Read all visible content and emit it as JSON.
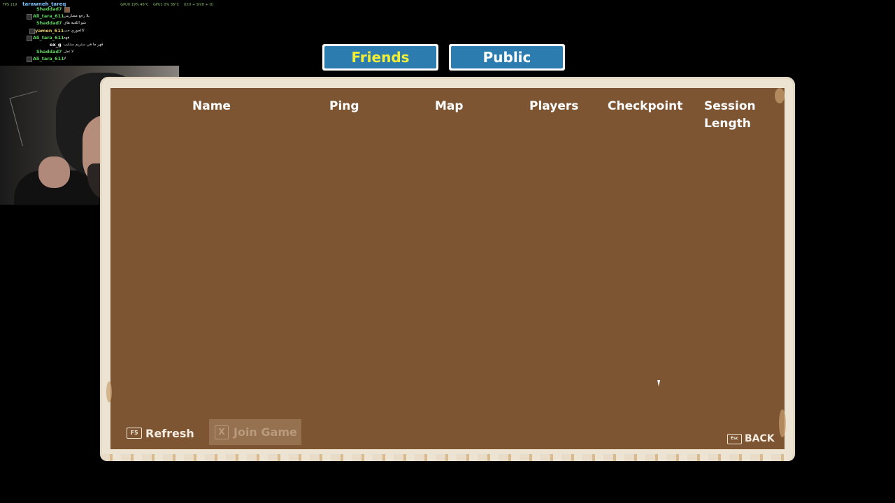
{
  "hud": {
    "stats": "FPS 119",
    "username": "tarawneh_tareq",
    "gpu0": "GPU0 19% 46°C",
    "gpu1": "GPU1 0% 36°C",
    "hotkey": "(Ctrl + Shift + O)"
  },
  "chat": [
    {
      "user": "Shaddad7",
      "message": "",
      "color": "#5fd35f"
    },
    {
      "user": "Ali_tara_611",
      "message": "يلا رجع مصاريني",
      "color": "#5fd35f"
    },
    {
      "user": "Shaddad7",
      "message": "شو اللعبة هاي",
      "color": "#5fd35f"
    },
    {
      "user": "yamen_611",
      "message": "كالجوري حب",
      "color": "#e2c86a"
    },
    {
      "user": "Ali_tara_611",
      "message": "ههه",
      "color": "#5fd35f"
    },
    {
      "user": "ox_g",
      "message": "قهر ما في ستريم ستايب",
      "color": "#ffffff"
    },
    {
      "user": "Shaddad7",
      "message": "لا تجل",
      "color": "#5fd35f"
    },
    {
      "user": "Ali_tara_611",
      "message": "لا",
      "color": "#5fd35f"
    }
  ],
  "tabs": {
    "friends": "Friends",
    "public": "Public"
  },
  "columns": {
    "name": "Name",
    "ping": "Ping",
    "map": "Map",
    "players": "Players",
    "checkpoint": "Checkpoint",
    "session_line1": "Session",
    "session_line2": "Length"
  },
  "buttons": {
    "refresh_key": "F5",
    "refresh": "Refresh",
    "join_key": "X",
    "join": "Join Game",
    "back_key": "Esc",
    "back": "BACK"
  },
  "colors": {
    "tab_blue": "#2c7cb0",
    "active_tab_text": "#f2ee35",
    "panel_brown": "#7d5533",
    "frame_cream": "#ece3d3"
  }
}
